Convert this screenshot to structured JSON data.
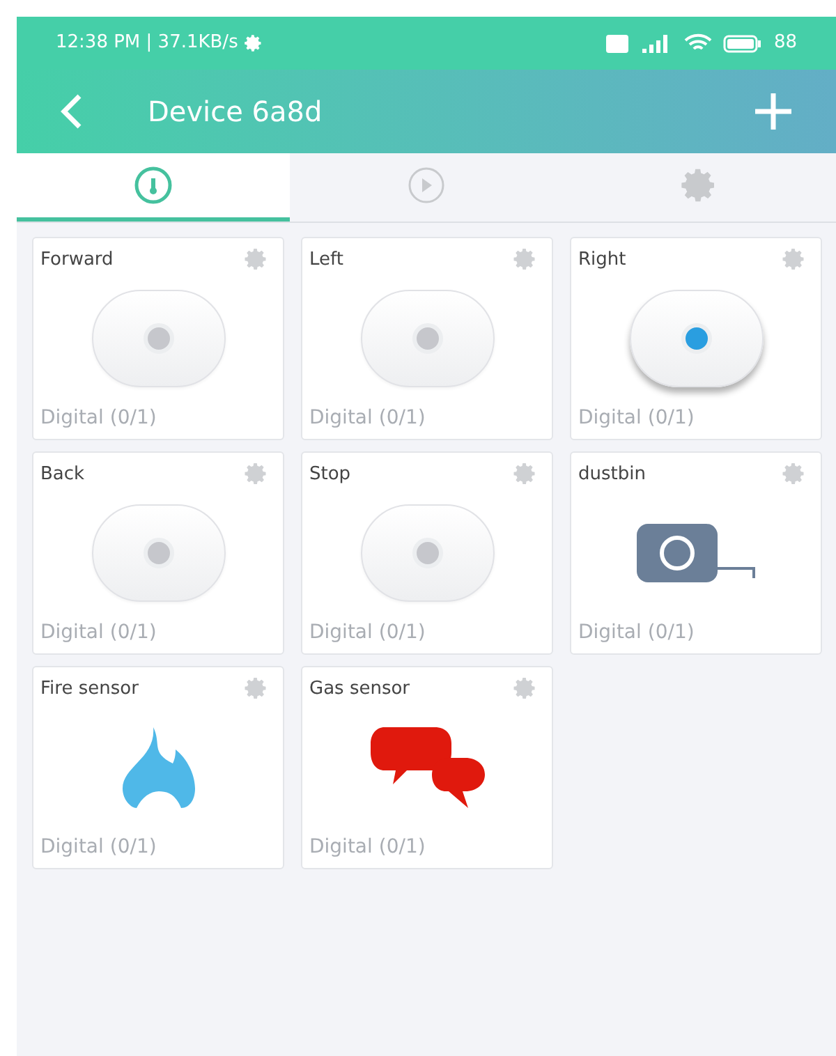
{
  "status_bar": {
    "left": "12:38 PM | 37.1KB/s",
    "battery": "88"
  },
  "header": {
    "title": "Device 6a8d"
  },
  "tabs": [
    {
      "kind": "gauge",
      "selected": true
    },
    {
      "kind": "play",
      "selected": false
    },
    {
      "kind": "gear",
      "selected": false
    }
  ],
  "widgets": [
    {
      "name": "Forward",
      "kind": "button",
      "on": false,
      "caption": "Digital (0/1)"
    },
    {
      "name": "Left",
      "kind": "button",
      "on": false,
      "caption": "Digital (0/1)"
    },
    {
      "name": "Right",
      "kind": "button",
      "on": true,
      "caption": "Digital (0/1)"
    },
    {
      "name": "Back",
      "kind": "button",
      "on": false,
      "caption": "Digital (0/1)"
    },
    {
      "name": "Stop",
      "kind": "button",
      "on": false,
      "caption": "Digital (0/1)"
    },
    {
      "name": "dustbin",
      "kind": "tape",
      "caption": "Digital (0/1)"
    },
    {
      "name": "Fire sensor",
      "kind": "fire",
      "caption": "Digital (0/1)"
    },
    {
      "name": "Gas sensor",
      "kind": "chat",
      "caption": "Digital (0/1)"
    }
  ]
}
